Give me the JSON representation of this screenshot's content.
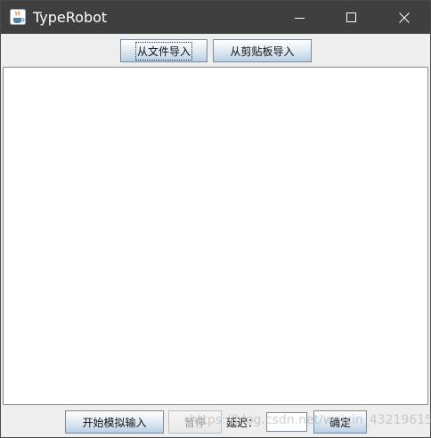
{
  "window": {
    "title": "TypeRobot"
  },
  "top_toolbar": {
    "import_file_label": "从文件导入",
    "import_clipboard_label": "从剪贴板导入"
  },
  "text_area": {
    "value": ""
  },
  "bottom_toolbar": {
    "start_label": "开始模拟输入",
    "pause_label": "暂停",
    "delay_label": "延迟：",
    "delay_value": "",
    "confirm_label": "确定"
  },
  "watermark": {
    "text": "https://blog.csdn.net/weixin_43219615"
  },
  "icons": {
    "app": "java-coffee-icon",
    "minimize": "minimize-icon",
    "maximize": "maximize-icon",
    "close": "close-icon"
  },
  "colors": {
    "titlebar": "#3f3f3f",
    "window_bg": "#eeeeee",
    "button_gradient_bottom": "#b8cfe5"
  }
}
